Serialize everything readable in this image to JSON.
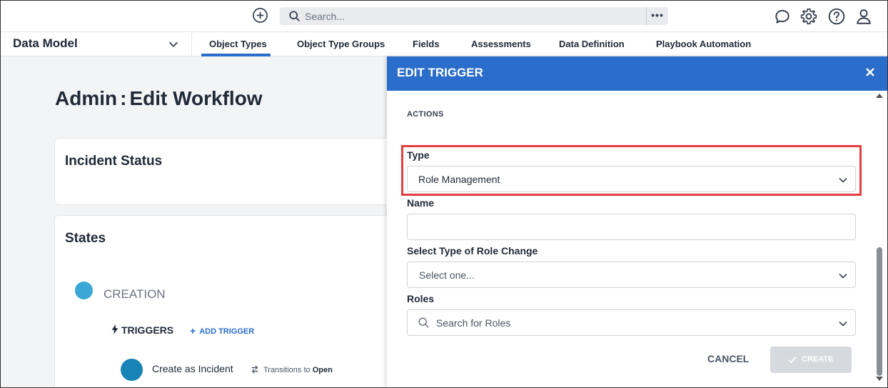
{
  "topbar": {
    "search_placeholder": "Search...",
    "more_label": "•••",
    "icons": [
      "add-circle-icon",
      "search-icon",
      "chat-icon",
      "gear-icon",
      "help-icon",
      "user-icon"
    ]
  },
  "subnav": {
    "selector_label": "Data Model",
    "tabs": [
      {
        "label": "Object Types",
        "active": true
      },
      {
        "label": "Object Type Groups"
      },
      {
        "label": "Fields"
      },
      {
        "label": "Assessments"
      },
      {
        "label": "Data Definition"
      },
      {
        "label": "Playbook Automation"
      }
    ]
  },
  "page": {
    "title_left": "Admin",
    "title_sep": ":",
    "title_right": "Edit Workflow",
    "card1_title": "Incident Status",
    "card2_title": "States",
    "state_name": "CREATION",
    "triggers_label": "TRIGGERS",
    "add_trigger_label": "ADD TRIGGER",
    "trigger_name": "Create as Incident",
    "transitions_label": "Transitions to",
    "transitions_target": "Open"
  },
  "drawer": {
    "title": "EDIT TRIGGER",
    "section": "ACTIONS",
    "type_label": "Type",
    "type_value": "Role Management",
    "name_label": "Name",
    "name_value": "",
    "role_change_label": "Select Type of Role Change",
    "role_change_placeholder": "Select one...",
    "roles_label": "Roles",
    "roles_placeholder": "Search for Roles",
    "cancel_label": "CANCEL",
    "create_label": "CREATE"
  },
  "colors": {
    "accent": "#2a6dcb",
    "highlight": "#e53e3e",
    "state_dot": "#3ba7d6",
    "trigger_dot": "#1783b7"
  }
}
